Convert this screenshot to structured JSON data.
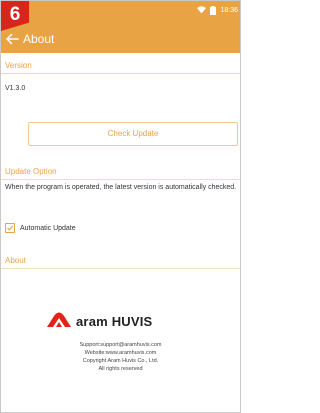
{
  "step_badge": "6",
  "status_bar": {
    "time": "18:36",
    "icons": [
      "wifi-icon",
      "battery-icon"
    ]
  },
  "header": {
    "title": "About",
    "back_icon": "arrow-left-icon"
  },
  "version_section": {
    "title": "Version",
    "value": "V1.3.0"
  },
  "check_update_button": "Check Update",
  "update_option_section": {
    "title": "Update Option",
    "description": "When the program is operated, the latest version is automatically checked.",
    "auto_update_label": "Automatic Update",
    "auto_update_checked": true
  },
  "about_section": {
    "title": "About"
  },
  "brand": {
    "logo_text": "aram HUVIS",
    "support": "Support:support@aramhuvis.com",
    "website": "Website:www.aramhuvis.com",
    "copyright": "Copyright Aram Huvis Co., Ltd.",
    "rights": "All rights reserved"
  },
  "colors": {
    "accent": "#e8a444",
    "badge": "#d9261c",
    "logo_red": "#e3231a"
  }
}
